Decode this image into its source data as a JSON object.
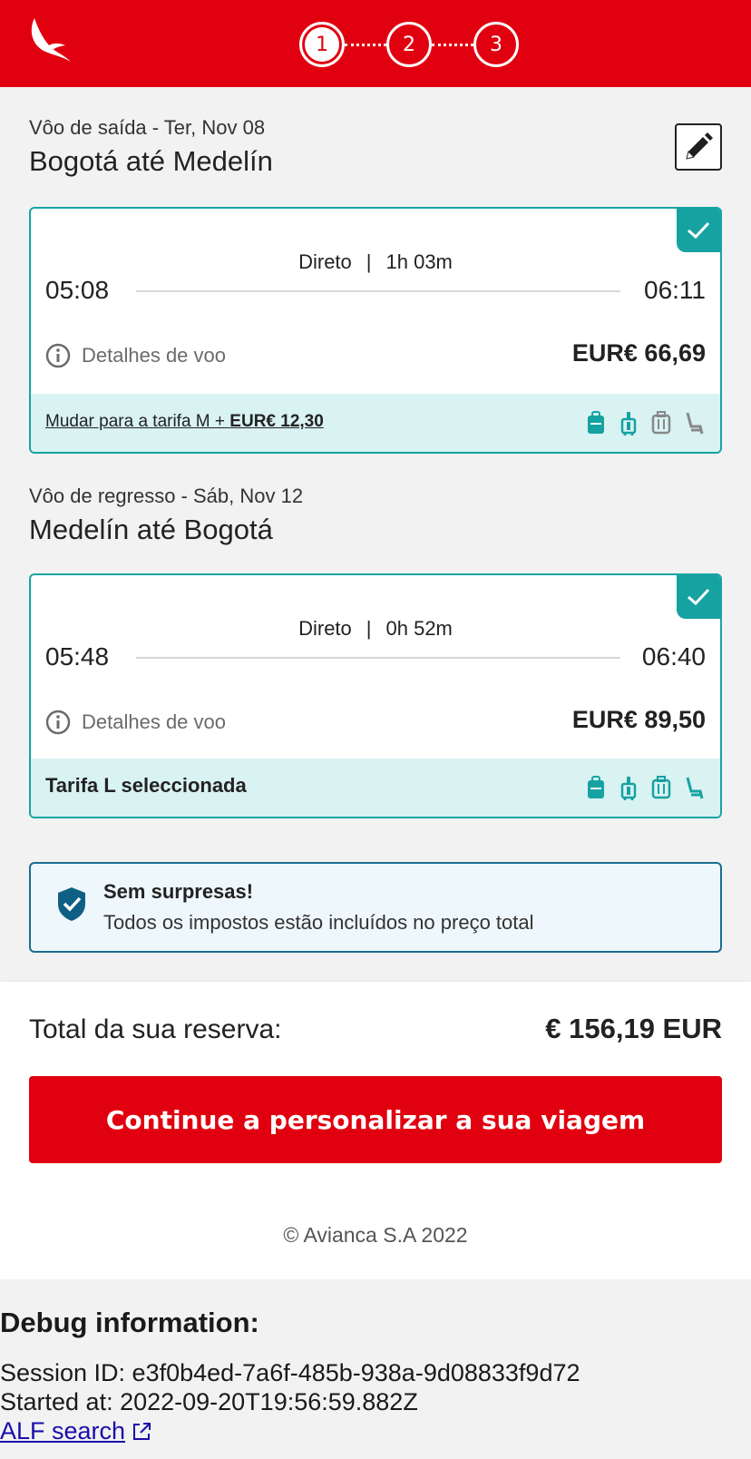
{
  "header": {
    "logo": "avianca-bird-logo",
    "steps": [
      "1",
      "2",
      "3"
    ],
    "active_step": 1,
    "brand_color": "#e1000f"
  },
  "outbound": {
    "subtitle": "Vôo de saída - Ter, Nov 08",
    "title": "Bogotá até Medelín",
    "stops": "Direto",
    "duration": "1h 03m",
    "departure": "05:08",
    "arrival": "06:11",
    "details_label": "Detalhes de voo",
    "price": "EUR€ 66,69",
    "fare_change_text": "Mudar para a tarifa M + ",
    "fare_change_price": "EUR€ 12,30",
    "fare_icons": [
      "backpack-icon",
      "carry-on-icon",
      "checked-bag-icon-grey",
      "seat-icon-grey"
    ]
  },
  "inbound": {
    "subtitle": "Vôo de regresso - Sáb, Nov 12",
    "title": "Medelín até Bogotá",
    "stops": "Direto",
    "duration": "0h 52m",
    "departure": "05:48",
    "arrival": "06:40",
    "details_label": "Detalhes de voo",
    "price": "EUR€ 89,50",
    "fare_selected": "Tarifa L seleccionada",
    "fare_icons": [
      "backpack-icon",
      "carry-on-icon",
      "checked-bag-icon",
      "seat-icon"
    ]
  },
  "notice": {
    "title": "Sem surpresas!",
    "text": "Todos os impostos estão incluídos no preço total"
  },
  "summary": {
    "total_label": "Total da sua reserva:",
    "total_value": "€ 156,19 EUR",
    "continue_label": "Continue a personalizar a sua viagem"
  },
  "footer": {
    "copyright": "© Avianca S.A 2022"
  },
  "debug": {
    "title": "Debug information:",
    "session": "Session ID: e3f0b4ed-7a6f-485b-938a-9d08833f9d72",
    "started": "Started at: 2022-09-20T19:56:59.882Z",
    "link_label": "ALF search"
  },
  "colors": {
    "teal": "#17a2a2",
    "fare_bg": "#d9f2f2",
    "notice_border": "#1b6d8f"
  }
}
